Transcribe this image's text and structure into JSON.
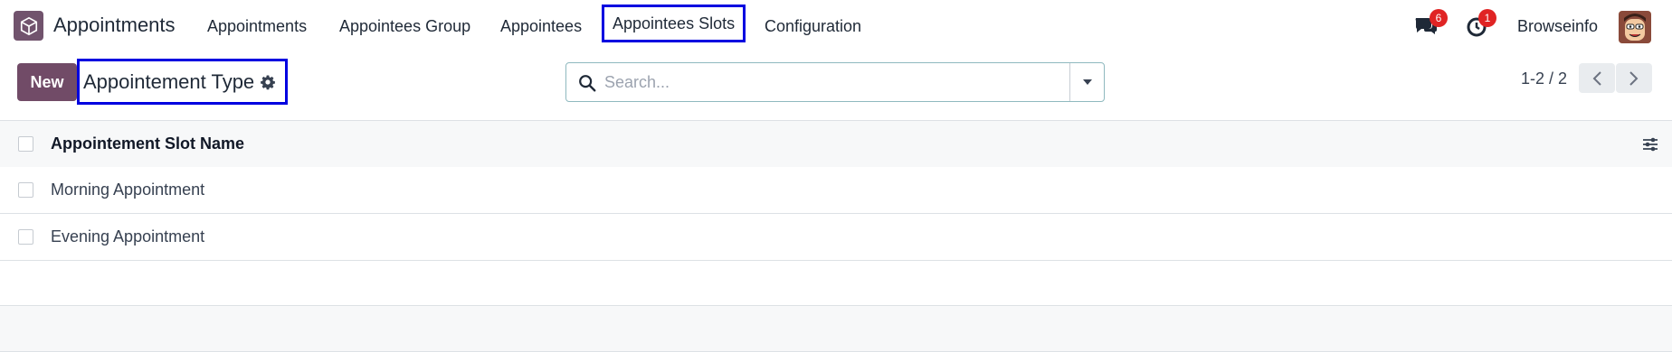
{
  "navbar": {
    "app_name": "Appointments",
    "menu": [
      "Appointments",
      "Appointees Group",
      "Appointees",
      "Appointees Slots",
      "Configuration"
    ],
    "messages_badge": "6",
    "activities_badge": "1",
    "user_name": "Browseinfo"
  },
  "control_panel": {
    "new_label": "New",
    "breadcrumb_title": "Appointement Type",
    "search_placeholder": "Search...",
    "pager_value": "1-2 / 2"
  },
  "list": {
    "column_header": "Appointement Slot Name",
    "rows": [
      "Morning Appointment",
      "Evening Appointment"
    ]
  },
  "colors": {
    "brand": "#714b67",
    "highlight_border": "#0000e0",
    "badge": "#e02424"
  },
  "icons": {
    "app": "box-icon",
    "messages": "chat-bubbles-icon",
    "activities": "clock-icon",
    "breadcrumb_action": "gear-icon",
    "search": "search-icon",
    "search_toggle": "caret-down-icon",
    "pager_prev": "chevron-left-icon",
    "pager_next": "chevron-right-icon",
    "optional_columns": "sliders-icon"
  }
}
